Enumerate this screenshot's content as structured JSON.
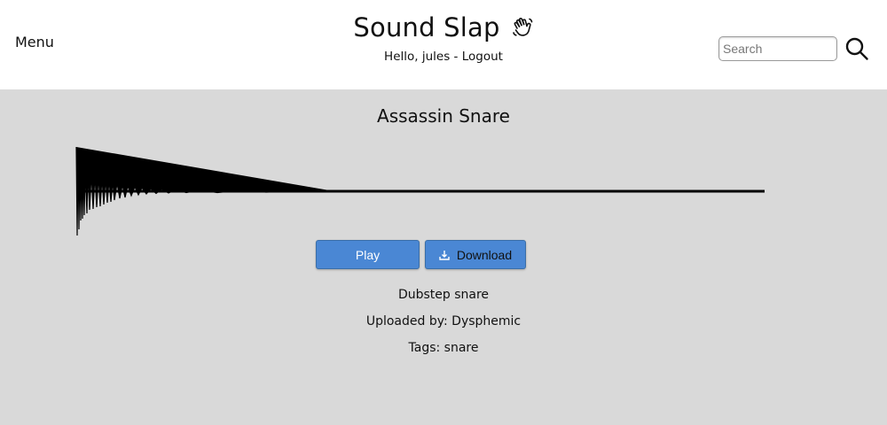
{
  "header": {
    "menu_label": "Menu",
    "site_title": "Sound Slap",
    "greeting": "Hello, jules",
    "separator": " - ",
    "logout_label": "Logout",
    "search": {
      "placeholder": "Search",
      "value": ""
    },
    "icons": {
      "brand": "waving-hand-icon",
      "search": "search-icon"
    }
  },
  "sound": {
    "title": "Assassin Snare",
    "play_label": "Play",
    "download_label": "Download",
    "description": "Dubstep snare",
    "uploaded_by": "Uploaded by: Dysphemic",
    "tags": "Tags: snare"
  },
  "colors": {
    "page_background": "#d9d9d9",
    "header_background": "#ffffff",
    "button_blue": "#4a87d4",
    "waveform": "#000000"
  }
}
